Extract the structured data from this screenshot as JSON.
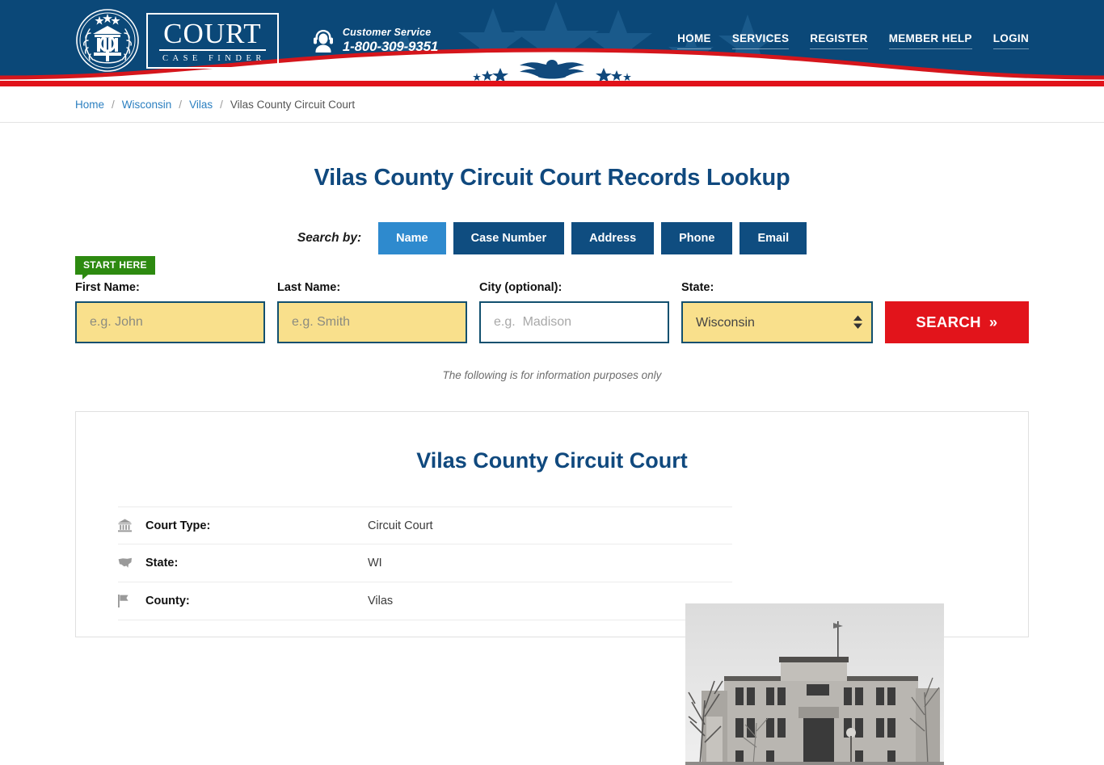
{
  "header": {
    "logo": {
      "word": "COURT",
      "sub": "CASE FINDER",
      "seal_icon": "court-seal-icon"
    },
    "customer_service": {
      "icon": "headset-agent-icon",
      "label": "Customer Service",
      "phone": "1-800-309-9351"
    },
    "nav": [
      {
        "label": "HOME"
      },
      {
        "label": "SERVICES"
      },
      {
        "label": "REGISTER"
      },
      {
        "label": "MEMBER HELP"
      },
      {
        "label": "LOGIN"
      }
    ],
    "colors": {
      "navy": "#0b4878",
      "red": "#e1121a",
      "white": "#ffffff"
    }
  },
  "breadcrumb": {
    "items": [
      {
        "label": "Home",
        "link": true
      },
      {
        "label": "Wisconsin",
        "link": true
      },
      {
        "label": "Vilas",
        "link": true
      },
      {
        "label": "Vilas County Circuit Court",
        "link": false
      }
    ],
    "separator": "/"
  },
  "main": {
    "page_title": "Vilas County Circuit Court Records Lookup",
    "search_by_label": "Search by:",
    "tabs": [
      {
        "label": "Name",
        "active": true
      },
      {
        "label": "Case Number",
        "active": false
      },
      {
        "label": "Address",
        "active": false
      },
      {
        "label": "Phone",
        "active": false
      },
      {
        "label": "Email",
        "active": false
      }
    ],
    "start_here_badge": "START HERE",
    "form": {
      "first_name": {
        "label": "First Name:",
        "placeholder": "e.g. John",
        "value": ""
      },
      "last_name": {
        "label": "Last Name:",
        "placeholder": "e.g. Smith",
        "value": ""
      },
      "city": {
        "label": "City (optional):",
        "placeholder": "e.g.  Madison",
        "value": ""
      },
      "state": {
        "label": "State:",
        "selected": "Wisconsin"
      },
      "search_button": "SEARCH",
      "search_button_chevron": "»"
    },
    "disclaimer": "The following is for information purposes only"
  },
  "card": {
    "title": "Vilas County Circuit Court",
    "photo_alt": "Vilas County Courthouse black and white photograph",
    "details": [
      {
        "icon": "bank-icon",
        "label": "Court Type:",
        "value": "Circuit Court"
      },
      {
        "icon": "us-map-icon",
        "label": "State:",
        "value": "WI"
      },
      {
        "icon": "flag-icon",
        "label": "County:",
        "value": "Vilas"
      }
    ]
  }
}
